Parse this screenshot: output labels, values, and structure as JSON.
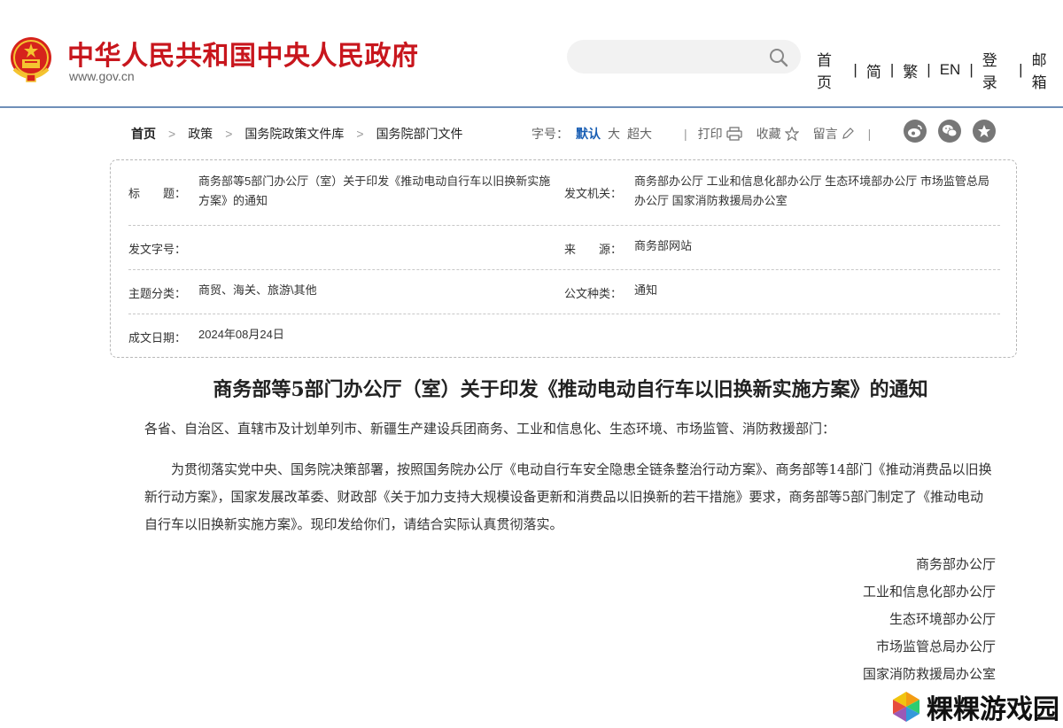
{
  "header": {
    "site_title": "中华人民共和国中央人民政府",
    "site_url": "www.gov.cn",
    "search_placeholder": "",
    "nav": [
      {
        "label": "首页"
      },
      {
        "label": "简"
      },
      {
        "label": "繁"
      },
      {
        "label": "EN"
      },
      {
        "label": "登录"
      },
      {
        "label": "邮箱"
      }
    ],
    "nav_separator": "|"
  },
  "breadcrumb": {
    "items": [
      "首页",
      "政策",
      "国务院政策文件库",
      "国务院部门文件"
    ],
    "separator": ">"
  },
  "font_size": {
    "label": "字号：",
    "options": [
      "默认",
      "大",
      "超大"
    ],
    "selected": "默认"
  },
  "tools": {
    "separator": "|",
    "print": "打印",
    "favorite": "收藏",
    "comment": "留言"
  },
  "meta": {
    "title_label": "标　　题：",
    "title_value": "商务部等5部门办公厅（室）关于印发《推动电动自行车以旧换新实施方案》的通知",
    "issuer_label": "发文机关：",
    "issuer_value": "商务部办公厅 工业和信息化部办公厅 生态环境部办公厅 市场监管总局办公厅 国家消防救援局办公室",
    "doc_no_label": "发文字号：",
    "doc_no_value": "",
    "source_label": "来　　源：",
    "source_value": "商务部网站",
    "topic_label": "主题分类：",
    "topic_value": "商贸、海关、旅游\\其他",
    "doc_type_label": "公文种类：",
    "doc_type_value": "通知",
    "date_label": "成文日期：",
    "date_value": "2024年08月24日"
  },
  "article": {
    "title": "商务部等5部门办公厅（室）关于印发《推动电动自行车以旧换新实施方案》的通知",
    "addressee": "各省、自治区、直辖市及计划单列市、新疆生产建设兵团商务、工业和信息化、生态环境、市场监管、消防救援部门：",
    "paragraph": "为贯彻落实党中央、国务院决策部署，按照国务院办公厅《电动自行车安全隐患全链条整治行动方案》、商务部等14部门《推动消费品以旧换新行动方案》，国家发展改革委、财政部《关于加力支持大规模设备更新和消费品以旧换新的若干措施》要求，商务部等5部门制定了《推动电动自行车以旧换新实施方案》。现印发给你们，请结合实际认真贯彻落实。",
    "signers": [
      "商务部办公厅",
      "工业和信息化部办公厅",
      "生态环境部办公厅",
      "市场监管总局办公厅",
      "国家消防救援局办公室"
    ]
  },
  "watermark": {
    "text": "粿粿游戏园"
  },
  "colors": {
    "brand_red": "#c8161d",
    "accent_blue": "#1a5fb4",
    "header_rule": "#6f8fb8"
  }
}
